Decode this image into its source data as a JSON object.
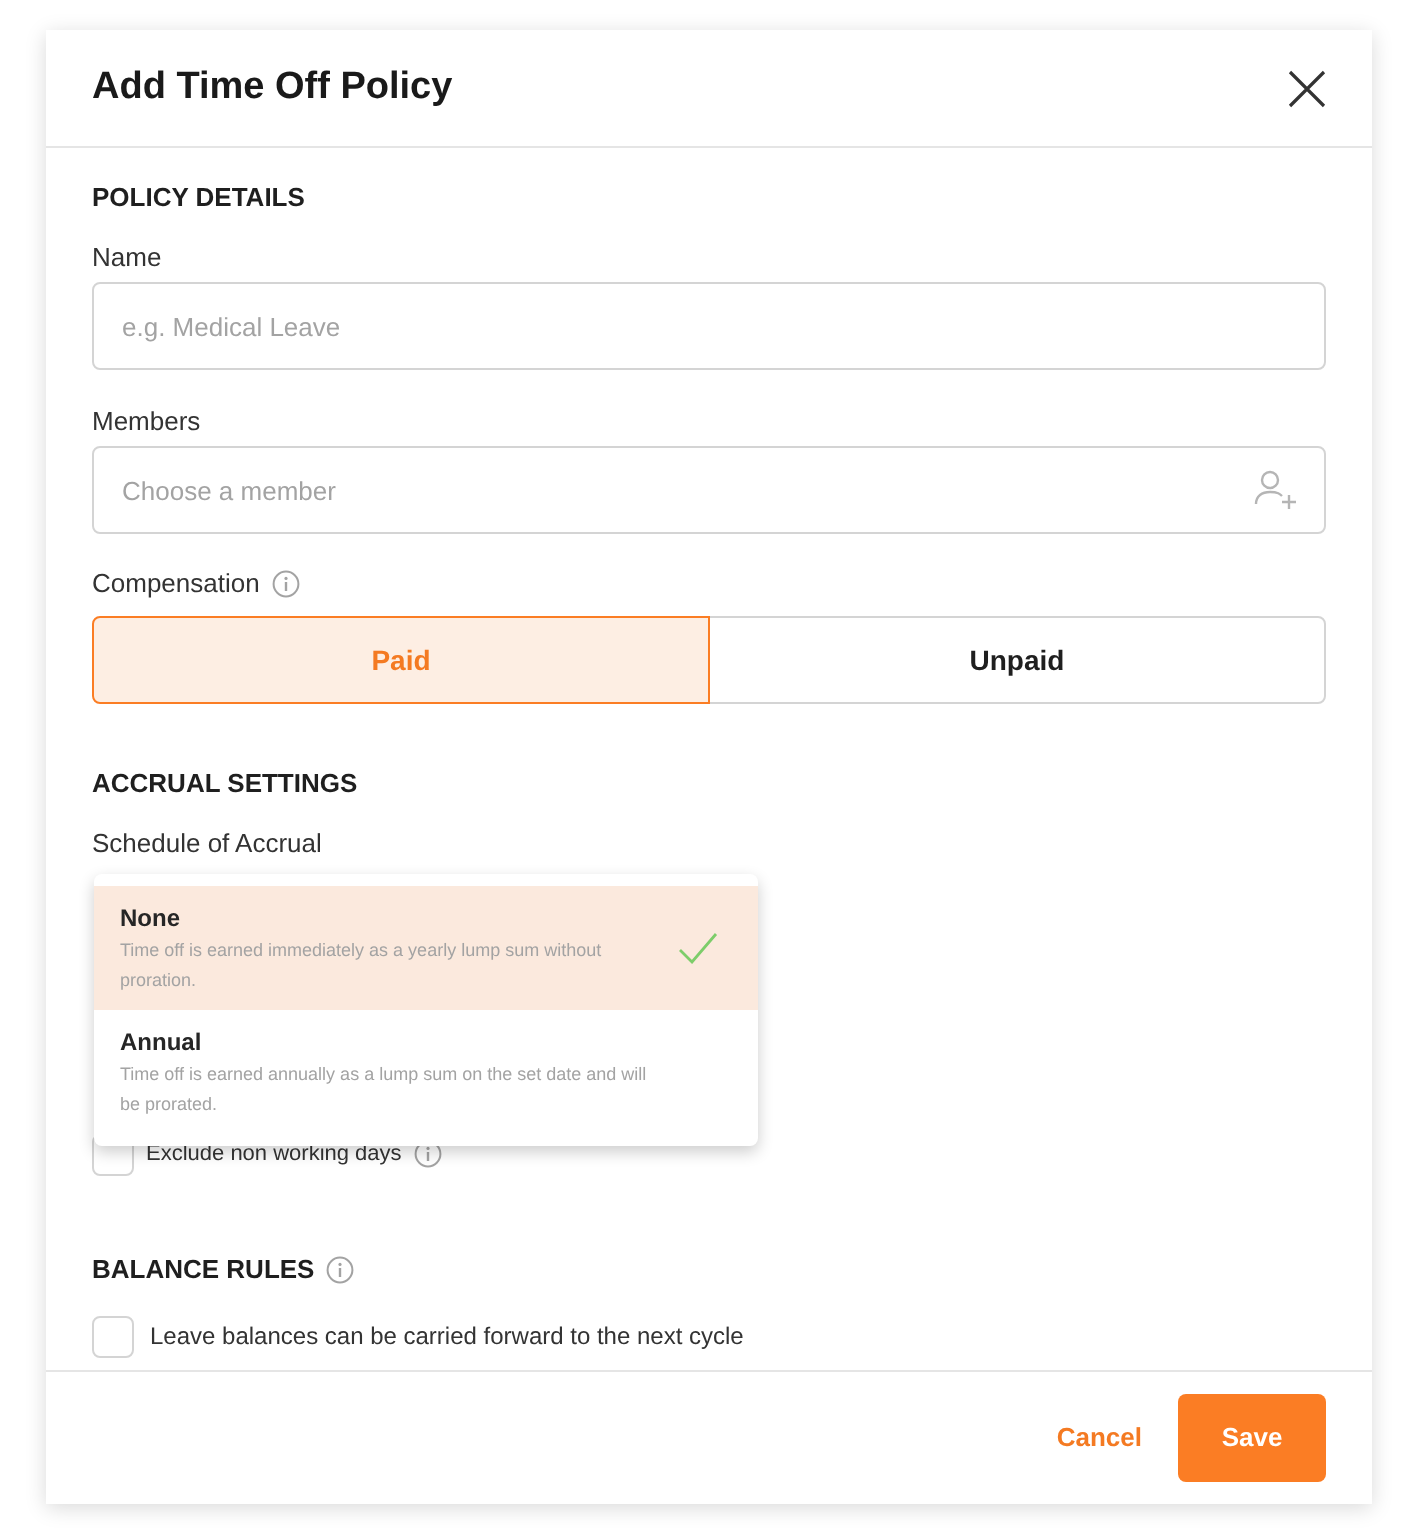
{
  "dialog": {
    "title": "Add Time Off Policy"
  },
  "policy_details": {
    "heading": "POLICY DETAILS",
    "name": {
      "label": "Name",
      "placeholder": "e.g. Medical Leave"
    },
    "members": {
      "label": "Members",
      "placeholder": "Choose a member"
    },
    "compensation": {
      "label": "Compensation",
      "options": [
        {
          "label": "Paid",
          "selected": true
        },
        {
          "label": "Unpaid",
          "selected": false
        }
      ]
    }
  },
  "accrual_settings": {
    "heading": "ACCRUAL SETTINGS",
    "schedule_label": "Schedule of Accrual",
    "schedule_options": [
      {
        "title": "None",
        "description": "Time off is earned immediately as a yearly lump sum without proration.",
        "selected": true
      },
      {
        "title": "Annual",
        "description": "Time off is earned annually as a lump sum on the set date and will be prorated.",
        "selected": false
      }
    ],
    "exclude_non_working_days": {
      "label": "Exclude non working days",
      "checked": false
    }
  },
  "balance_rules": {
    "heading": "BALANCE RULES",
    "carry_forward": {
      "label": "Leave balances can be carried forward to the next cycle",
      "checked": false
    }
  },
  "buttons": {
    "cancel": "Cancel",
    "save": "Save"
  }
}
